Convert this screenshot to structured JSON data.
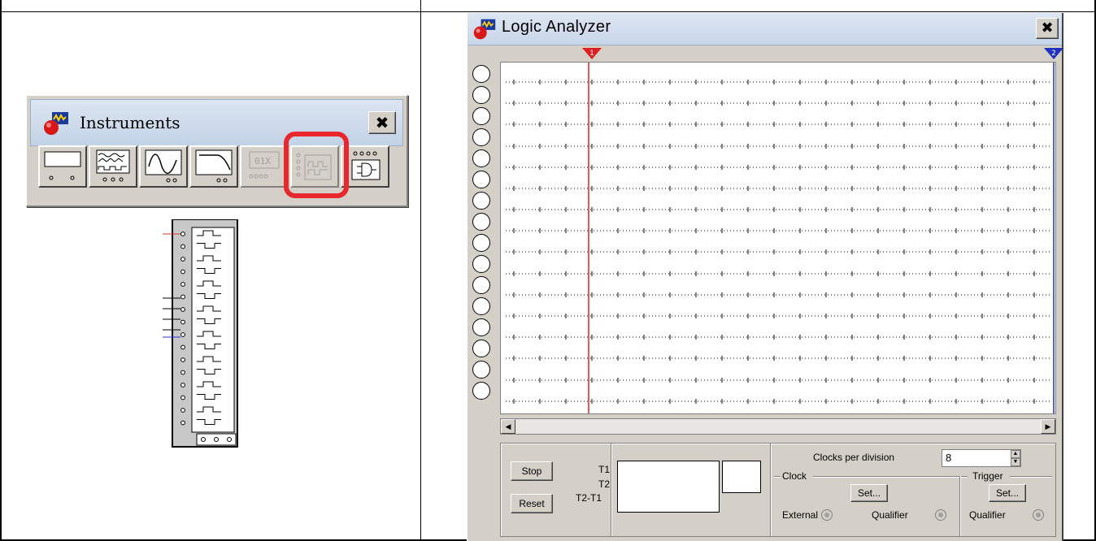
{
  "instruments": {
    "title": "Instruments",
    "close_label": "✖",
    "buttons": [
      "multimeter",
      "function-generator",
      "oscilloscope",
      "bode-plotter",
      "word-generator",
      "logic-analyzer",
      "logic-converter"
    ],
    "word_generator_text": "01X",
    "highlight_color": "#e8282e"
  },
  "logic_analyzer": {
    "title": "Logic Analyzer",
    "close_label": "✖",
    "cursor1_label": "1",
    "cursor2_label": "2",
    "cursor1_color": "#e02020",
    "cursor2_color": "#2030c0",
    "channel_count": 16,
    "controls": {
      "stop": "Stop",
      "reset": "Reset",
      "t1": "T1",
      "t2": "T2",
      "t2_t1": "T2-T1",
      "clocks_per_division_label": "Clocks per division",
      "clocks_per_division_value": "8",
      "clock_group": "Clock",
      "trigger_group": "Trigger",
      "clock_set": "Set...",
      "trigger_set": "Set...",
      "external": "External",
      "qualifier": "Qualifier",
      "trigger_qualifier": "Qualifier"
    }
  }
}
